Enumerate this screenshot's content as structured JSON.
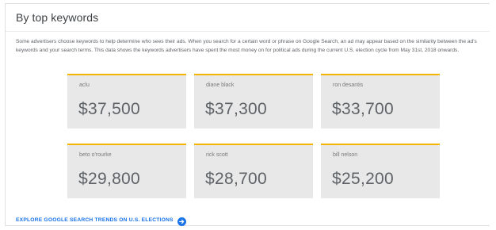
{
  "section": {
    "title": "By top keywords",
    "description": "Some advertisers choose keywords to help determine who sees their ads. When you search for a certain word or phrase on Google Search, an ad may appear based on the similarity between the ad's keywords and your search terms. This data shows the keywords advertisers have spent the most money on for political ads during the current U.S. election cycle from May 31st, 2018 onwards."
  },
  "keywords": [
    {
      "label": "aclu",
      "amount": "$37,500"
    },
    {
      "label": "diane black",
      "amount": "$37,300"
    },
    {
      "label": "ron desantis",
      "amount": "$33,700"
    },
    {
      "label": "beto o'rourke",
      "amount": "$29,800"
    },
    {
      "label": "rick scott",
      "amount": "$28,700"
    },
    {
      "label": "bill nelson",
      "amount": "$25,200"
    }
  ],
  "link": {
    "label": "EXPLORE GOOGLE SEARCH TRENDS ON U.S. ELECTIONS",
    "icon": "arrow-right-circle-icon"
  },
  "colors": {
    "accent": "#f5b400",
    "link": "#1a73e8",
    "tile_bg": "#e8e8e8"
  }
}
